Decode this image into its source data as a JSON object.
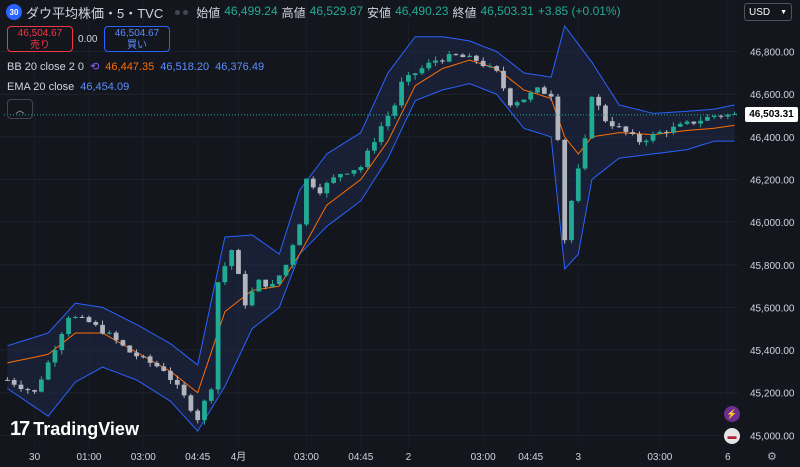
{
  "header": {
    "symbol_badge": "30",
    "title": "ダウ平均株価・5・TVC",
    "open_label": "始値",
    "open": "46,499.24",
    "high_label": "高値",
    "high": "46,529.87",
    "low_label": "安値",
    "low": "46,490.23",
    "close_label": "終値",
    "close": "46,503.31",
    "change": "+3.85 (+0.01%)"
  },
  "trade": {
    "sell_price": "46,504.67",
    "sell_label": "売り",
    "spread": "0.00",
    "buy_price": "46,504.67",
    "buy_label": "買い"
  },
  "indicators": {
    "bb": {
      "name": "BB 20 close 2 0",
      "basis": "46,447.35",
      "upper": "46,518.20",
      "lower": "46,376.49"
    },
    "ema": {
      "name": "EMA 20 close",
      "value": "46,454.09"
    }
  },
  "currency": "USD",
  "last_price": "46,503.31",
  "logo_text": "TradingView",
  "colors": {
    "up": "#22ab94",
    "bb": "#2962ff",
    "ema": "#ff6d00",
    "sell": "#f23645",
    "background": "#14161e"
  },
  "chart_data": {
    "type": "line",
    "y_range": [
      44950,
      46920
    ],
    "y_ticks": [
      "46,800.00",
      "46,600.00",
      "46,400.00",
      "46,200.00",
      "46,000.00",
      "45,800.00",
      "45,600.00",
      "45,400.00",
      "45,200.00",
      "45,000.00"
    ],
    "y_tick_values": [
      46800,
      46600,
      46400,
      46200,
      46000,
      45800,
      45600,
      45400,
      45200,
      45000
    ],
    "x_labels": [
      "30",
      "01:00",
      "03:00",
      "04:45",
      "4月",
      "03:00",
      "04:45",
      "2",
      "03:00",
      "04:45",
      "3",
      "03:00",
      "6"
    ],
    "x_label_index": [
      4,
      12,
      20,
      28,
      34,
      44,
      52,
      59,
      70,
      77,
      84,
      96,
      106
    ],
    "n": 108,
    "price_key": [
      [
        0,
        45260
      ],
      [
        4,
        45200
      ],
      [
        6,
        45340
      ],
      [
        9,
        45560
      ],
      [
        12,
        45530
      ],
      [
        15,
        45470
      ],
      [
        18,
        45390
      ],
      [
        21,
        45340
      ],
      [
        23,
        45310
      ],
      [
        26,
        45180
      ],
      [
        28,
        45080
      ],
      [
        30,
        45230
      ],
      [
        31,
        45720
      ],
      [
        33,
        45870
      ],
      [
        35,
        45620
      ],
      [
        37,
        45720
      ],
      [
        39,
        45700
      ],
      [
        41,
        45800
      ],
      [
        43,
        46000
      ],
      [
        44,
        46200
      ],
      [
        46,
        46150
      ],
      [
        49,
        46230
      ],
      [
        52,
        46260
      ],
      [
        55,
        46450
      ],
      [
        57,
        46550
      ],
      [
        58,
        46650
      ],
      [
        60,
        46700
      ],
      [
        63,
        46760
      ],
      [
        66,
        46780
      ],
      [
        69,
        46760
      ],
      [
        72,
        46700
      ],
      [
        74,
        46560
      ],
      [
        76,
        46580
      ],
      [
        78,
        46620
      ],
      [
        80,
        46600
      ],
      [
        81,
        46400
      ],
      [
        82,
        45920
      ],
      [
        83,
        46100
      ],
      [
        85,
        46380
      ],
      [
        86,
        46600
      ],
      [
        88,
        46480
      ],
      [
        91,
        46420
      ],
      [
        93,
        46380
      ],
      [
        96,
        46420
      ],
      [
        98,
        46440
      ],
      [
        101,
        46470
      ],
      [
        104,
        46500
      ],
      [
        107,
        46503
      ]
    ],
    "bb_upper_key": [
      [
        0,
        45420
      ],
      [
        6,
        45480
      ],
      [
        10,
        45620
      ],
      [
        14,
        45600
      ],
      [
        19,
        45520
      ],
      [
        24,
        45430
      ],
      [
        28,
        45330
      ],
      [
        32,
        45930
      ],
      [
        36,
        45940
      ],
      [
        40,
        45850
      ],
      [
        43,
        46150
      ],
      [
        47,
        46320
      ],
      [
        52,
        46420
      ],
      [
        56,
        46700
      ],
      [
        60,
        46870
      ],
      [
        64,
        46870
      ],
      [
        68,
        46850
      ],
      [
        72,
        46800
      ],
      [
        76,
        46700
      ],
      [
        80,
        46680
      ],
      [
        82,
        46920
      ],
      [
        86,
        46750
      ],
      [
        90,
        46550
      ],
      [
        95,
        46510
      ],
      [
        100,
        46520
      ],
      [
        104,
        46530
      ],
      [
        107,
        46550
      ]
    ],
    "bb_lower_key": [
      [
        0,
        45220
      ],
      [
        6,
        45090
      ],
      [
        10,
        45250
      ],
      [
        14,
        45320
      ],
      [
        19,
        45260
      ],
      [
        24,
        45160
      ],
      [
        28,
        45020
      ],
      [
        32,
        45230
      ],
      [
        36,
        45500
      ],
      [
        40,
        45600
      ],
      [
        43,
        45850
      ],
      [
        47,
        45980
      ],
      [
        52,
        46100
      ],
      [
        56,
        46300
      ],
      [
        60,
        46570
      ],
      [
        64,
        46620
      ],
      [
        68,
        46650
      ],
      [
        72,
        46600
      ],
      [
        76,
        46440
      ],
      [
        80,
        46400
      ],
      [
        82,
        45780
      ],
      [
        84,
        45850
      ],
      [
        86,
        46200
      ],
      [
        90,
        46300
      ],
      [
        95,
        46320
      ],
      [
        100,
        46340
      ],
      [
        104,
        46380
      ],
      [
        107,
        46380
      ]
    ],
    "ema_key": [
      [
        0,
        45340
      ],
      [
        6,
        45380
      ],
      [
        10,
        45480
      ],
      [
        14,
        45480
      ],
      [
        19,
        45390
      ],
      [
        24,
        45300
      ],
      [
        28,
        45200
      ],
      [
        32,
        45580
      ],
      [
        36,
        45680
      ],
      [
        40,
        45700
      ],
      [
        43,
        45850
      ],
      [
        47,
        46080
      ],
      [
        52,
        46200
      ],
      [
        56,
        46380
      ],
      [
        60,
        46640
      ],
      [
        64,
        46720
      ],
      [
        68,
        46760
      ],
      [
        72,
        46720
      ],
      [
        76,
        46620
      ],
      [
        80,
        46580
      ],
      [
        82,
        46400
      ],
      [
        84,
        46320
      ],
      [
        86,
        46400
      ],
      [
        90,
        46420
      ],
      [
        95,
        46410
      ],
      [
        100,
        46430
      ],
      [
        104,
        46440
      ],
      [
        107,
        46454
      ]
    ]
  }
}
